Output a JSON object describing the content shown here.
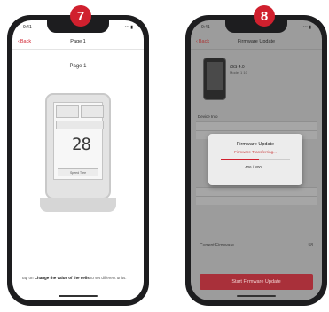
{
  "steps": [
    "7",
    "8"
  ],
  "accent_color": "#d0202e",
  "phone1": {
    "status": {
      "time": "9:41",
      "icons": "••• ▮"
    },
    "nav": {
      "back": "Back",
      "title": "Page 1"
    },
    "page_label": "Page 1",
    "device_value": "28",
    "device_footer": "Speed Tree",
    "footer": {
      "pre": "Tap on",
      "bold": "Change the value of the cells",
      "post": "to set different units."
    }
  },
  "phone2": {
    "status": {
      "time": "9:41",
      "icons": "••• ▮"
    },
    "nav": {
      "back": "Back",
      "title": "Firmware Update"
    },
    "device_name": "iGS 4.0",
    "device_sub": "Model 1 10",
    "section_label": "Device Info",
    "dialog": {
      "title": "Firmware Update",
      "status": "Firmware Transferring...",
      "count": "406 / 800 ...",
      "progress": 0.55
    },
    "current_firmware_label": "Current Firmware",
    "current_firmware_value": "58",
    "button_label": "Start Firmware Update"
  }
}
